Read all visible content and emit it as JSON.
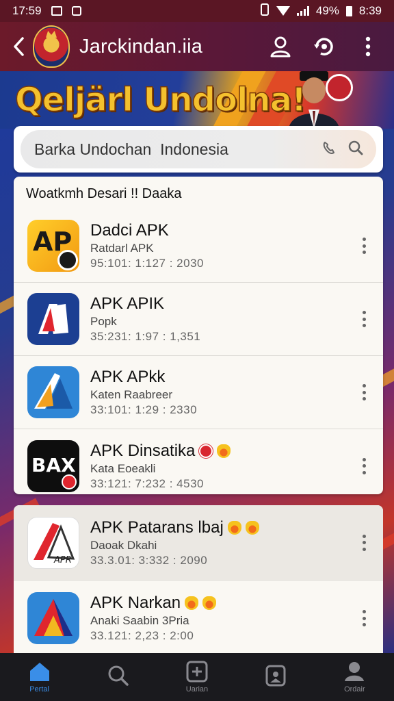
{
  "status_bar": {
    "time": "17:59",
    "left_icons": [
      "notification-icon",
      "image-icon"
    ],
    "battery_text": "49%",
    "right_time": "8:39"
  },
  "app_bar": {
    "title": "Jarckindan.iia",
    "icons": [
      "back-icon",
      "logo",
      "profile-icon",
      "refresh-icon",
      "more-vert-icon"
    ]
  },
  "banner": {
    "title": "Qeljärl Undolna!"
  },
  "search": {
    "value": "Barka Undochan  Indonesia",
    "icons": [
      "voice-icon",
      "search-icon"
    ]
  },
  "list": {
    "section_title": "Woatkmh Desari !! Daaka",
    "items": [
      {
        "name": "Dadci APK",
        "dev": "Ratdarl APK",
        "meta": "95:101:  1:127  :  2030",
        "badges": []
      },
      {
        "name": "APK APIK",
        "dev": "Popk",
        "meta": "35:231:  1:97  :  1,351",
        "badges": []
      },
      {
        "name": "APK APkk",
        "dev": "Katen Raabreer",
        "meta": "33:101:  1:29  :  2330",
        "badges": []
      },
      {
        "name": "APK Dinsatika",
        "dev": "Kata Eoeakli",
        "meta": "33:121:  7:232  :  4530",
        "badges": [
          "red-badge-icon",
          "crown-badge-icon"
        ]
      }
    ]
  },
  "list2": {
    "items": [
      {
        "name": "APK Patarans lbaj",
        "dev": "Daoak Dkahi",
        "meta": "33.3.01:  3:332  :  2090",
        "badges": [
          "crown-badge-icon",
          "crown-badge-icon"
        ]
      },
      {
        "name": "APK Narkan",
        "dev": "Anaki Saabin 3Pria",
        "meta": "33.121:  2,23  :  2:00",
        "badges": [
          "crown-badge-icon",
          "crown-badge-icon"
        ]
      }
    ]
  },
  "bottom_nav": {
    "items": [
      {
        "label": "Pertal",
        "icon": "home-icon",
        "active": true
      },
      {
        "label": "",
        "icon": "search-icon",
        "active": false
      },
      {
        "label": "Uarian",
        "icon": "add-box-icon",
        "active": false
      },
      {
        "label": "",
        "icon": "gallery-icon",
        "active": false
      },
      {
        "label": "Ordair",
        "icon": "person-icon",
        "active": false
      }
    ]
  },
  "colors": {
    "app_bar": "#6c1a2a",
    "banner_text": "#f4c12e",
    "nav_active": "#3a8ee8"
  }
}
